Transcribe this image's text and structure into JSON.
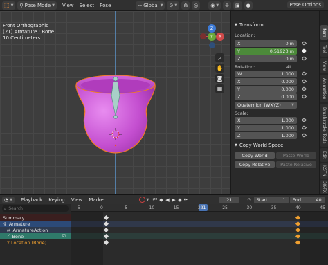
{
  "header": {
    "mode": "Pose Mode",
    "menus": [
      "View",
      "Select",
      "Pose"
    ],
    "orientation": "Global",
    "right_label": "Pose Options"
  },
  "viewport": {
    "view_name": "Front Orthographic",
    "object_info": "(21) Armature : Bone",
    "scale": "10 Centimeters",
    "gizmo": {
      "y_label": "Y",
      "z_label": "Z",
      "x_label": "X"
    },
    "tools": [
      "zoom-icon",
      "hand-icon",
      "camera-icon",
      "grid-icon"
    ],
    "colors": {
      "cup": "#cc55d6",
      "outline": "#f08020",
      "bone": "#a8d0c8"
    }
  },
  "properties": {
    "transform_title": "Transform",
    "location_label": "Location:",
    "location": [
      {
        "axis": "X",
        "value": "0 m"
      },
      {
        "axis": "Y",
        "value": "0.51923 m"
      },
      {
        "axis": "Z",
        "value": "0 m"
      }
    ],
    "rotation_label": "Rotation:",
    "rotation_mode_tag": "4L",
    "rotation": [
      {
        "axis": "W",
        "value": "1.000"
      },
      {
        "axis": "X",
        "value": "0.000"
      },
      {
        "axis": "Y",
        "value": "0.000"
      },
      {
        "axis": "Z",
        "value": "0.000"
      }
    ],
    "rotation_mode": "Quaternion (WXYZ)",
    "scale_label": "Scale:",
    "scale": [
      {
        "axis": "X",
        "value": "1.000"
      },
      {
        "axis": "Y",
        "value": "1.000"
      },
      {
        "axis": "Z",
        "value": "1.000"
      }
    ],
    "copy_ws_title": "Copy World Space",
    "copy_world": "Copy World",
    "paste_world": "Paste World",
    "copy_relative": "Copy Relative",
    "paste_relative": "Paste Relative"
  },
  "side_tabs": [
    "Item",
    "Tool",
    "View",
    "Animation",
    "Brushstroke Tools",
    "Edit",
    "KSTN",
    "3K-FX"
  ],
  "timeline": {
    "menus": [
      "Playback",
      "Keying",
      "View",
      "Marker"
    ],
    "current_frame": "21",
    "start_label": "Start",
    "start_value": "1",
    "end_label": "End",
    "end_value": "40",
    "search_placeholder": "Search",
    "ruler": [
      "-5",
      "0",
      "5",
      "10",
      "15",
      "20",
      "21",
      "25",
      "30",
      "35",
      "40",
      "45"
    ],
    "channels": [
      {
        "name": "Summary"
      },
      {
        "name": "Armature"
      },
      {
        "name": "ArmatureAction"
      },
      {
        "name": "Bone"
      },
      {
        "name": "Y Location (Bone)"
      }
    ],
    "colors": {
      "playhead": "#4772b3",
      "selected_key": "#f0a030"
    }
  }
}
